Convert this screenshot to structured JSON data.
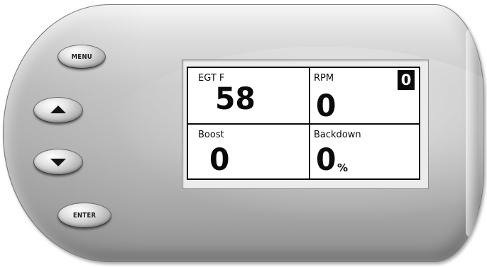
{
  "buttons": {
    "menu_label": "MENU",
    "up_icon": "arrow-up-icon",
    "down_icon": "arrow-down-icon",
    "enter_label": "ENTER"
  },
  "gauges": [
    {
      "label": "EGT F",
      "value": "58",
      "unit": ""
    },
    {
      "label": "RPM",
      "value": "0",
      "unit": ""
    },
    {
      "label": "Boost",
      "value": "0",
      "unit": ""
    },
    {
      "label": "Backdown",
      "value": "0",
      "unit": "%"
    }
  ],
  "indicator": {
    "value": "0"
  },
  "colors": {
    "display_text": "#0a0a0a",
    "display_background": "#ffffff",
    "housing": "#bcbcbc"
  }
}
